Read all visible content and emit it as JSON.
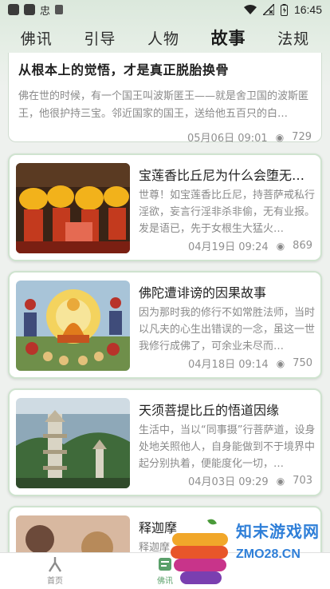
{
  "status": {
    "time": "16:45"
  },
  "tabs": [
    "佛讯",
    "引导",
    "人物",
    "故事",
    "法规"
  ],
  "active_tab": "故事",
  "articles": [
    {
      "title": "从根本上的觉悟，才是真正脱胎换骨",
      "summary": "佛在世的时候，有一个国王叫波斯匿王——就是舍卫国的波斯匿王，他很护持三宝。邻近国家的国王，送给他五百只的白…",
      "date": "05月06日 09:01",
      "views": "729"
    },
    {
      "title": "宝莲香比丘尼为什么会堕无…",
      "summary": "世尊！如宝莲香比丘尼，持菩萨戒私行淫欲，妄言行淫非杀非偷，无有业报。发是语已，先于女根生大猛火…",
      "date": "04月19日 09:24",
      "views": "869",
      "thumb": "lamps"
    },
    {
      "title": "佛陀遭诽谤的因果故事",
      "summary": "因为那时我的修行不如常胜法师，当时以凡夫的心生出错误的一念，虽这一世我修行成佛了，可余业未尽而…",
      "date": "04月18日 09:14",
      "views": "750",
      "thumb": "buddha-painting"
    },
    {
      "title": "天须菩提比丘的悟道因缘",
      "summary": "生活中，当以“同事摄”行菩萨道，设身处地关照他人，自身能做到不于境界中起分别执着，便能度化一切，…",
      "date": "04月03日 09:29",
      "views": "703",
      "thumb": "pagoda"
    },
    {
      "title": "释迦摩",
      "summary": "释迦摩",
      "thumb": "statue"
    }
  ],
  "nav": [
    {
      "label": "首页",
      "icon": "home-icon"
    },
    {
      "label": "佛讯",
      "icon": "news-icon"
    },
    {
      "label": "",
      "icon": "profile-icon"
    }
  ],
  "watermark": {
    "text": "知末游戏网",
    "sub": "ZMO28.CN"
  },
  "colors": {
    "accent": "#5aa06a",
    "card_border": "#cfe3cf",
    "meta": "#8f8f8f"
  }
}
